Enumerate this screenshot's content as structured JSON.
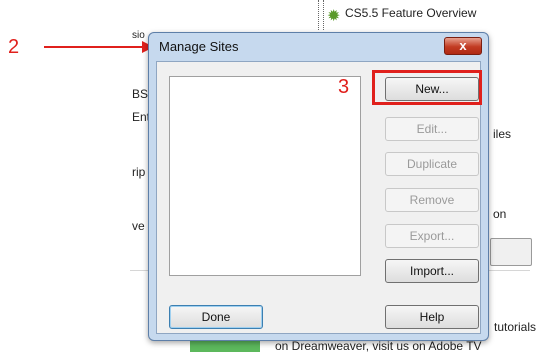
{
  "background": {
    "feature_title": "CS5.5 Feature Overview",
    "left_fragments": [
      "sio",
      "BS",
      "Ent",
      "rip",
      "ve"
    ],
    "right_fragments": [
      "iles",
      "on"
    ],
    "bottom_line1": "tutorials",
    "bottom_line2": "on Dreamweaver, visit us on Adobe TV"
  },
  "annotations": {
    "label_2": "2",
    "label_3": "3",
    "color": "#e0201c"
  },
  "dialog": {
    "title": "Manage Sites",
    "close_glyph": "x",
    "buttons": {
      "new": "New...",
      "edit": "Edit...",
      "duplicate": "Duplicate",
      "remove": "Remove",
      "export": "Export...",
      "import": "Import...",
      "done": "Done",
      "help": "Help"
    }
  }
}
